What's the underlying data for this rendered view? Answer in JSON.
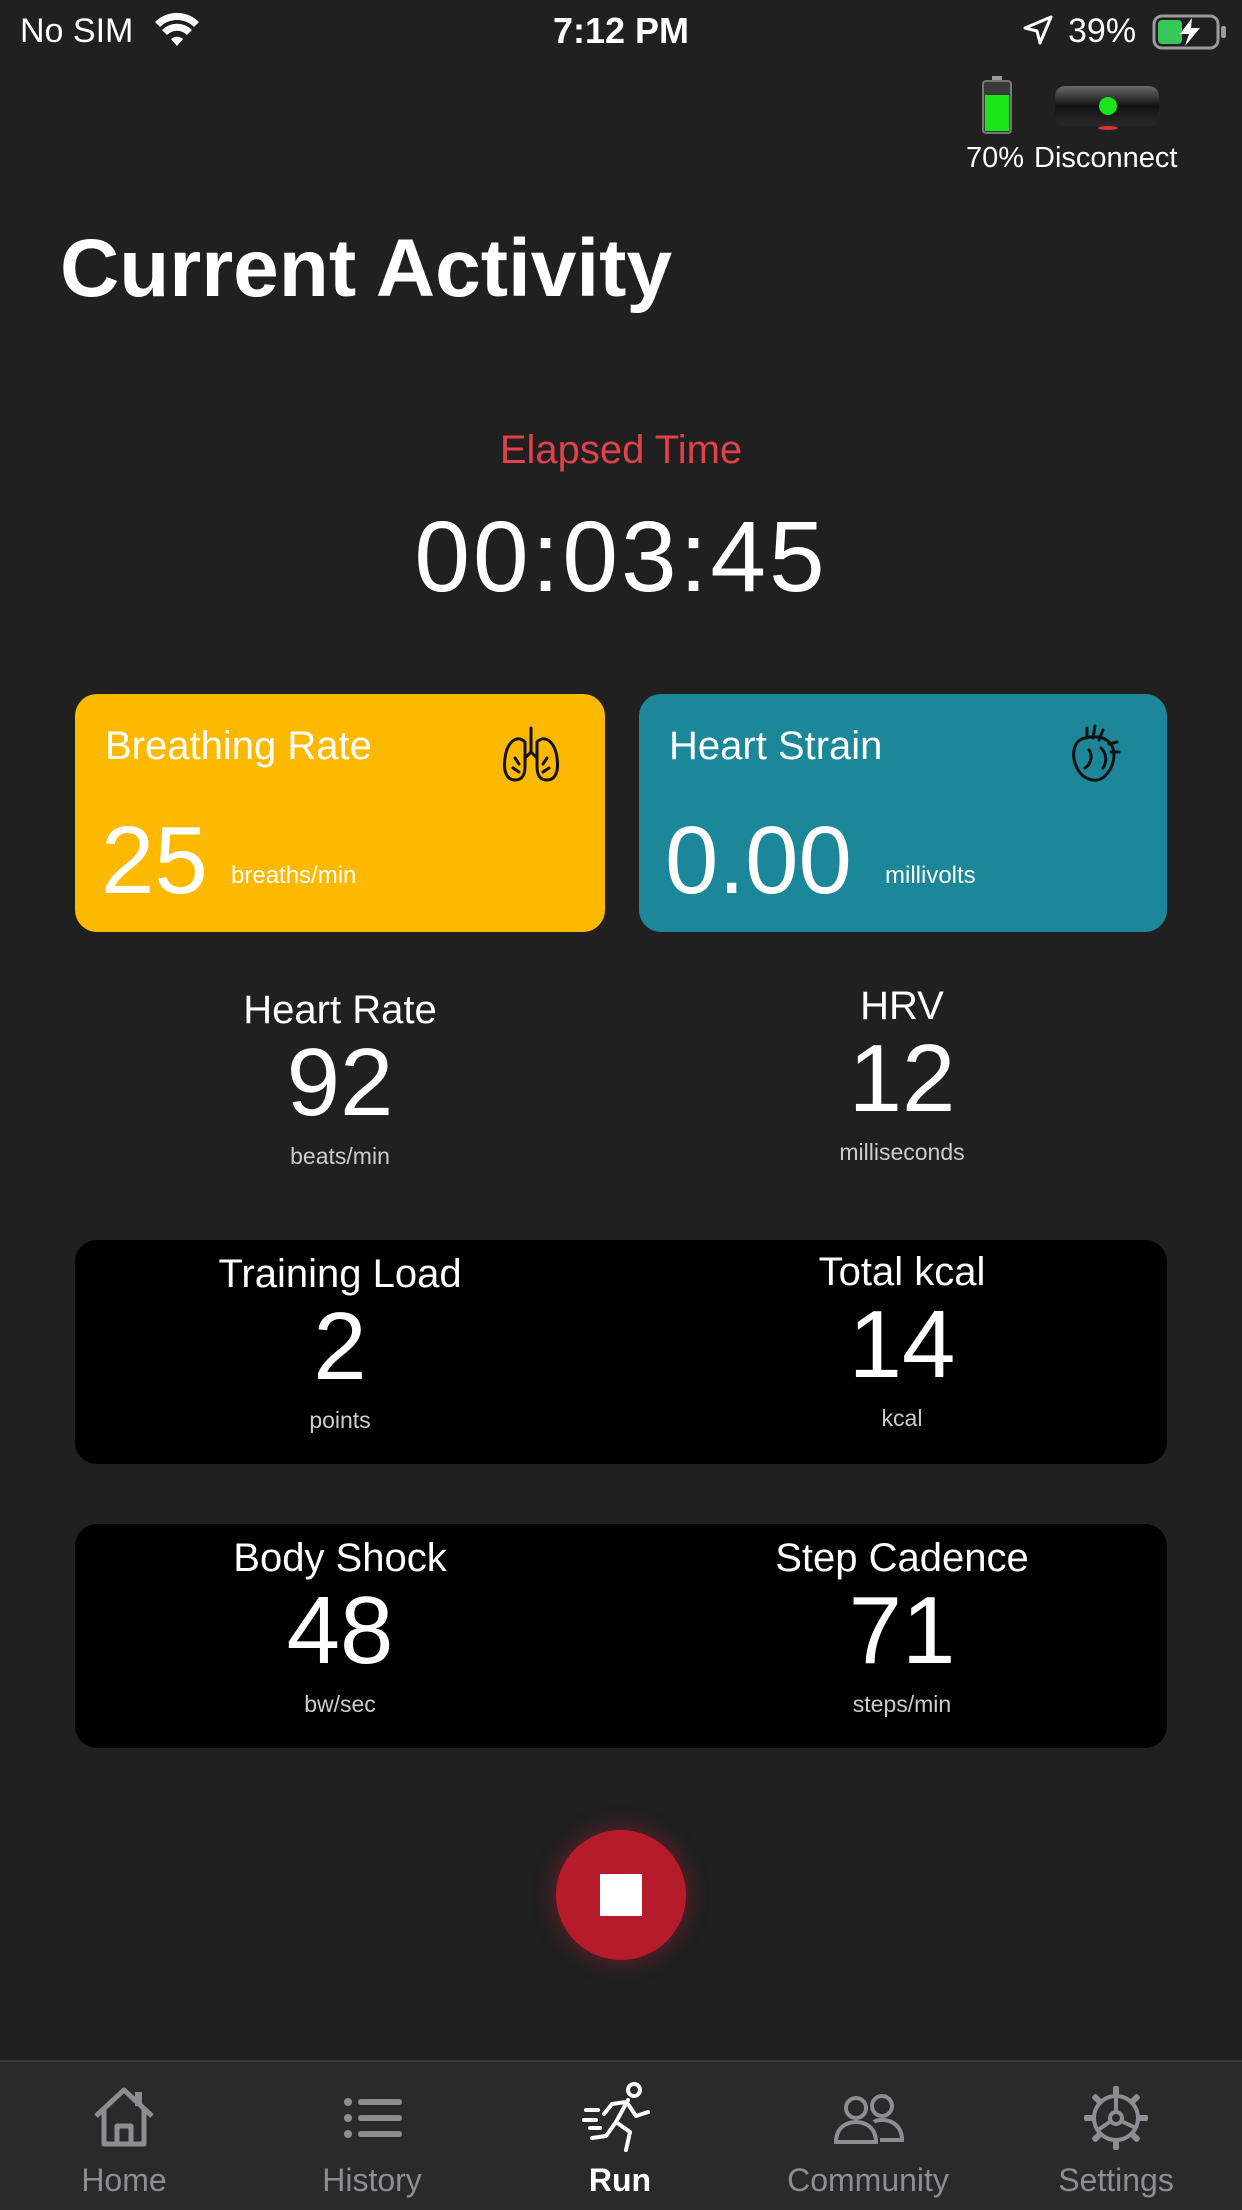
{
  "status_bar": {
    "carrier": "No SIM",
    "time": "7:12 PM",
    "battery": "39%"
  },
  "device": {
    "battery_pct": "70%",
    "battery_level": 0.7,
    "disconnect_label": "Disconnect",
    "accent_green": "#19e619"
  },
  "page": {
    "title": "Current Activity",
    "elapsed_label": "Elapsed Time",
    "elapsed_time": "00:03:45"
  },
  "cards": {
    "breathing": {
      "title": "Breathing Rate",
      "value": "25",
      "unit": "breaths/min",
      "color": "#fdb900",
      "icon": "lungs-icon"
    },
    "heart_strain": {
      "title": "Heart Strain",
      "value": "0.00",
      "unit": "millivolts",
      "color": "#1b8798",
      "icon": "heart-icon"
    }
  },
  "metrics": {
    "heart_rate": {
      "label": "Heart Rate",
      "value": "92",
      "unit": "beats/min"
    },
    "hrv": {
      "label": "HRV",
      "value": "12",
      "unit": "milliseconds"
    },
    "training_load": {
      "label": "Training Load",
      "value": "2",
      "unit": "points"
    },
    "total_kcal": {
      "label": "Total kcal",
      "value": "14",
      "unit": "kcal"
    },
    "body_shock": {
      "label": "Body Shock",
      "value": "48",
      "unit": "bw/sec"
    },
    "step_cadence": {
      "label": "Step Cadence",
      "value": "71",
      "unit": "steps/min"
    }
  },
  "stop_button": {
    "color": "#b61b2c",
    "icon": "stop-icon"
  },
  "tabs": [
    {
      "label": "Home",
      "icon": "home-icon"
    },
    {
      "label": "History",
      "icon": "list-icon"
    },
    {
      "label": "Run",
      "icon": "runner-icon",
      "active": true
    },
    {
      "label": "Community",
      "icon": "people-icon"
    },
    {
      "label": "Settings",
      "icon": "gear-icon"
    }
  ]
}
